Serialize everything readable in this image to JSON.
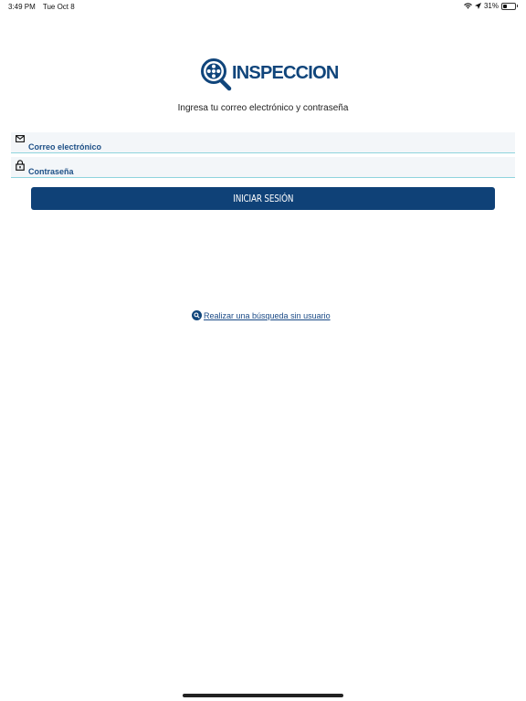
{
  "status_bar": {
    "time": "3:49 PM",
    "date": "Tue Oct 8",
    "battery": "31%",
    "battery_level": 0.31
  },
  "logo": {
    "text": "INSPECCION",
    "icon": "magnifier-reel-icon"
  },
  "instructions": "Ingresa tu correo electrónico y contraseña",
  "form": {
    "email_label": "Correo electrónico",
    "email_icon": "envelope-icon",
    "password_label": "Contraseña",
    "password_icon": "lock-icon"
  },
  "login_button": "INICIAR SESIÓN",
  "guest_search_link": "Realizar una búsqueda sin usuario",
  "colors": {
    "brand_blue": "#0f4177",
    "field_underline": "#8ed4dd",
    "field_bg": "#f3f6f9"
  }
}
